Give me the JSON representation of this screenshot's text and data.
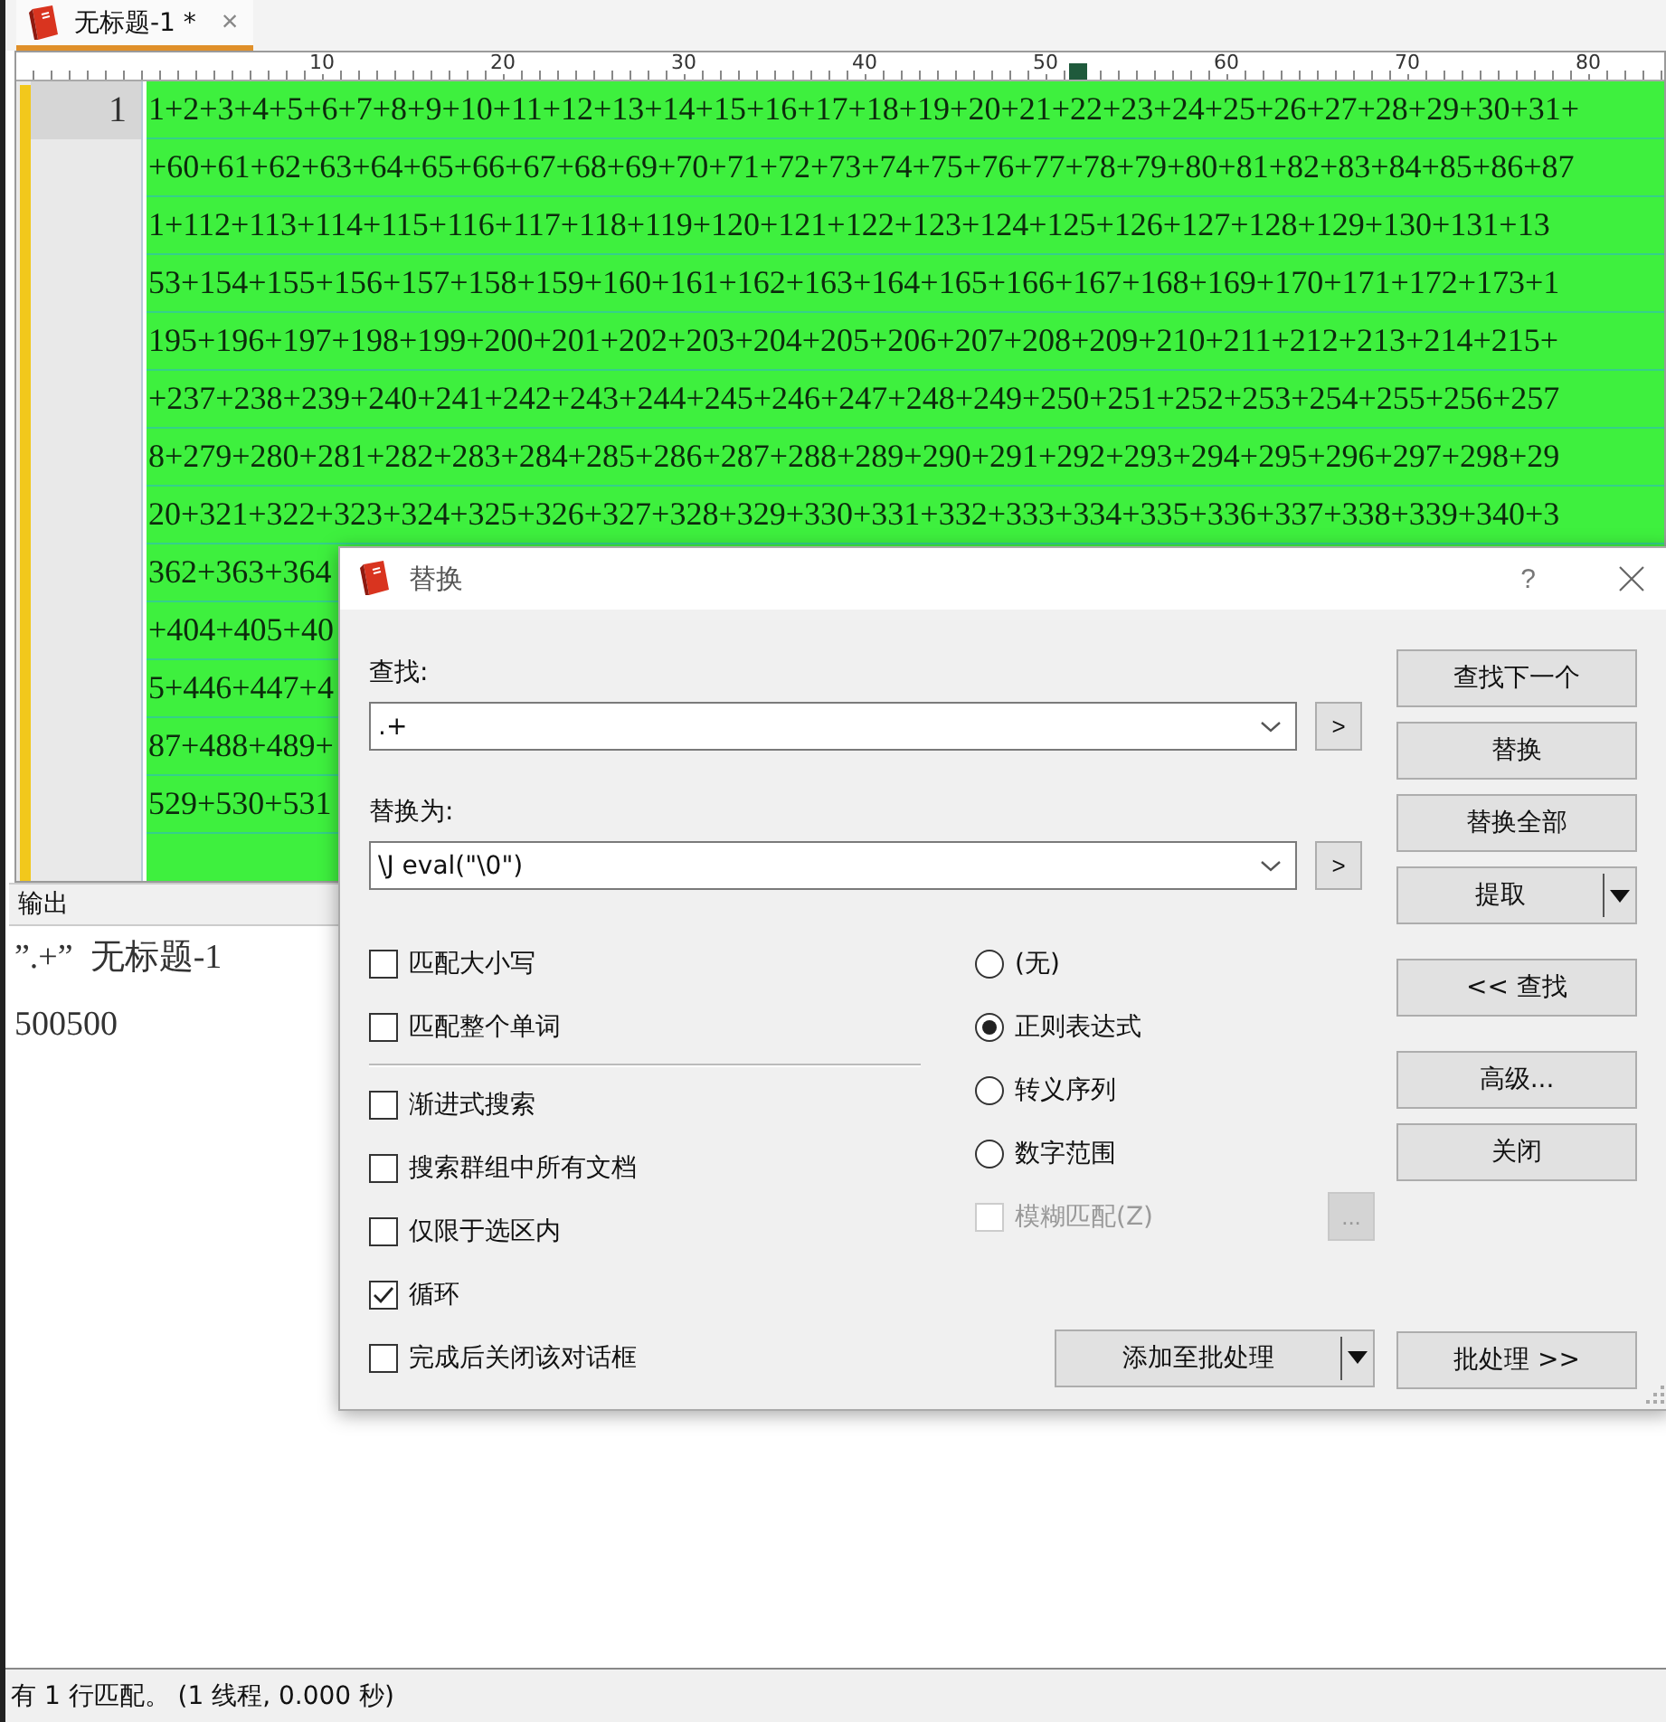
{
  "tab": {
    "title": "无标题-1 *",
    "close": "×"
  },
  "ruler": {
    "labels": [
      "10",
      "20",
      "30",
      "40",
      "50",
      "60",
      "70",
      "80"
    ]
  },
  "editor": {
    "line_number": "1",
    "selected": true,
    "lines": [
      "1+2+3+4+5+6+7+8+9+10+11+12+13+14+15+16+17+18+19+20+21+22+23+24+25+26+27+28+29+30+31+",
      "+60+61+62+63+64+65+66+67+68+69+70+71+72+73+74+75+76+77+78+79+80+81+82+83+84+85+86+87",
      "1+112+113+114+115+116+117+118+119+120+121+122+123+124+125+126+127+128+129+130+131+13",
      "53+154+155+156+157+158+159+160+161+162+163+164+165+166+167+168+169+170+171+172+173+1",
      "195+196+197+198+199+200+201+202+203+204+205+206+207+208+209+210+211+212+213+214+215+",
      "+237+238+239+240+241+242+243+244+245+246+247+248+249+250+251+252+253+254+255+256+257",
      "8+279+280+281+282+283+284+285+286+287+288+289+290+291+292+293+294+295+296+297+298+29",
      "20+321+322+323+324+325+326+327+328+329+330+331+332+333+334+335+336+337+338+339+340+3",
      "362+363+364",
      "+404+405+40",
      "5+446+447+4",
      "87+488+489+",
      "529+530+531"
    ]
  },
  "output": {
    "title": "输出",
    "lines": [
      "”.+”  无标题-1",
      "500500"
    ]
  },
  "status_bar": "有 1 行匹配。 (1 线程, 0.000 秒)",
  "dialog": {
    "title": "替换",
    "help": "?",
    "find": {
      "label": "查找:",
      "value": ".+",
      "expand": ">"
    },
    "replace": {
      "label": "替换为:",
      "value": "\\J eval(\"\\0\")",
      "expand": ">"
    },
    "match_options": [
      {
        "label": "匹配大小写",
        "checked": false
      },
      {
        "label": "匹配整个单词",
        "checked": false
      }
    ],
    "search_options": [
      {
        "label": "渐进式搜索",
        "checked": false
      },
      {
        "label": "搜索群组中所有文档",
        "checked": false
      },
      {
        "label": "仅限于选区内",
        "checked": false
      },
      {
        "label": "循环",
        "checked": true
      },
      {
        "label": "完成后关闭该对话框",
        "checked": false
      }
    ],
    "modes": [
      {
        "label": "(无)",
        "selected": false
      },
      {
        "label": "正则表达式",
        "selected": true
      },
      {
        "label": "转义序列",
        "selected": false
      },
      {
        "label": "数字范围",
        "selected": false
      }
    ],
    "fuzzy": {
      "label": "模糊匹配(Z)",
      "checked": false,
      "disabled": true,
      "more": "..."
    },
    "batch_add": "添加至批处理",
    "button_groups": [
      [
        {
          "label": "查找下一个",
          "kind": "plain"
        },
        {
          "label": "替换",
          "kind": "plain"
        },
        {
          "label": "替换全部",
          "kind": "plain"
        },
        {
          "label": "提取",
          "kind": "split"
        }
      ],
      [
        {
          "label": "<< 查找",
          "kind": "plain"
        }
      ],
      [
        {
          "label": "高级...",
          "kind": "plain"
        },
        {
          "label": "关闭",
          "kind": "plain"
        }
      ]
    ],
    "batch_button": "批处理 >>"
  }
}
